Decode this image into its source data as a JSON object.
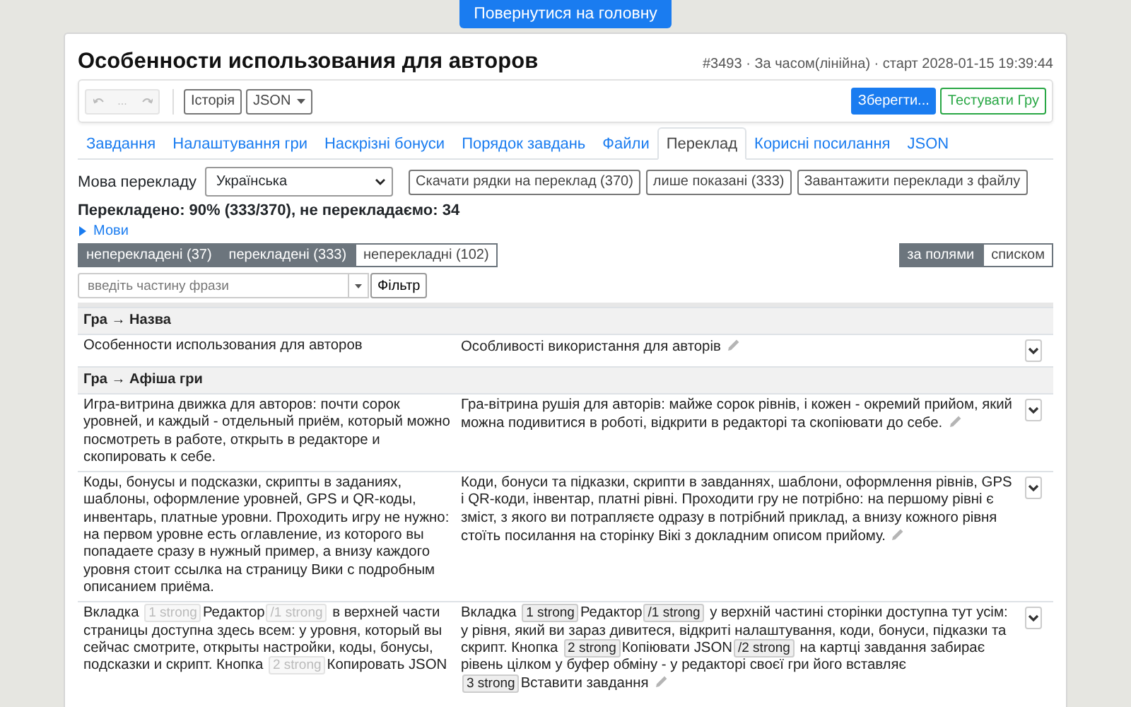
{
  "back_button": "Повернутися на головну",
  "header": {
    "title": "Особенности использования для авторов",
    "meta": "#3493 · За часом(лінійна) · старт 2028-01-15 19:39:44"
  },
  "toolbar": {
    "undo_disabled": true,
    "more_label": "...",
    "history": "Історія",
    "json_menu": "JSON",
    "save": "Зберегти...",
    "test": "Тестувати Гру"
  },
  "tabs": [
    {
      "label": "Завдання",
      "selected": false
    },
    {
      "label": "Налаштування гри",
      "selected": false
    },
    {
      "label": "Наскрізні бонуси",
      "selected": false
    },
    {
      "label": "Порядок завдань",
      "selected": false
    },
    {
      "label": "Файли",
      "selected": false
    },
    {
      "label": "Переклад",
      "selected": true
    },
    {
      "label": "Корисні посилання",
      "selected": false
    },
    {
      "label": "JSON",
      "selected": false
    }
  ],
  "language": {
    "label": "Мова перекладу",
    "value": "Українська"
  },
  "actions": [
    "Скачати рядки на переклад (370)",
    "лише показані (333)",
    "Завантажити переклади з файлу"
  ],
  "summary": "Перекладено: 90% (333/370), не перекладаємо: 34",
  "languages_toggle": {
    "label": "Мови",
    "expanded": false
  },
  "filters": [
    {
      "label": "неперекладені (37)",
      "selected": true
    },
    {
      "label": "перекладені (333)",
      "selected": true
    },
    {
      "label": "неперекладні (102)",
      "selected": false
    }
  ],
  "views": [
    {
      "label": "за полями",
      "selected": true
    },
    {
      "label": "списком",
      "selected": false
    }
  ],
  "search": {
    "placeholder": "введіть частину фрази",
    "button": "Фільтр"
  },
  "rows": [
    {
      "kind": "section",
      "title": "Гра → Назва"
    },
    {
      "kind": "entry",
      "source": [
        {
          "kind": "text",
          "text": "Особенности использования для авторов"
        }
      ],
      "target": [
        {
          "kind": "text",
          "text": "Особливості використання для авторів"
        }
      ]
    },
    {
      "kind": "section",
      "title": "Гра → Афіша гри"
    },
    {
      "kind": "entry",
      "source": [
        {
          "kind": "text",
          "text": "Игра-витрина движка для авторов: почти сорок уровней, и каждый - отдельный приём, который можно посмотреть в работе, открыть в редакторе и скопировать к себе."
        }
      ],
      "target": [
        {
          "kind": "text",
          "text": "Гра-вітрина рушія для авторів: майже сорок рівнів, і кожен - окремий прийом, який можна подивитися в роботі, відкрити в редакторі та скопіювати до себе."
        }
      ]
    },
    {
      "kind": "entry",
      "source": [
        {
          "kind": "text",
          "text": "Коды, бонусы и подсказки, скрипты в заданиях, шаблоны, оформление уровней, GPS и QR-коды, инвентарь, платные уровни. Проходить игру не нужно: на первом уровне есть оглавление, из которого вы попадаете сразу в нужный пример, а внизу каждого уровня стоит ссылка на страницу Вики с подробным описанием приёма."
        }
      ],
      "target": [
        {
          "kind": "text",
          "text": "Коди, бонуси та підказки, скрипти в завданнях, шаблони, оформлення рівнів, GPS і QR-коди, інвентар, платні рівні. Проходити гру не потрібно: на першому рівні є зміст, з якого ви потрапляєте одразу в потрібний приклад, а внизу кожного рівня стоїть посилання на сторінку Вікі з докладним описом прийому."
        }
      ]
    },
    {
      "kind": "entry",
      "source": [
        {
          "kind": "text",
          "text": "Вкладка "
        },
        {
          "kind": "tag",
          "text": "1 strong",
          "faded": true
        },
        {
          "kind": "text",
          "text": "Редактор"
        },
        {
          "kind": "tag",
          "text": "/1 strong",
          "faded": true
        },
        {
          "kind": "text",
          "text": " в верхней части страницы доступна здесь всем: у уровня, который вы сейчас смотрите, открыты настройки, коды, бонусы, подсказки и скрипт. Кнопка "
        },
        {
          "kind": "tag",
          "text": "2 strong",
          "faded": true
        },
        {
          "kind": "text",
          "text": "Копировать JSON"
        }
      ],
      "target": [
        {
          "kind": "text",
          "text": "Вкладка "
        },
        {
          "kind": "tag",
          "text": "1 strong",
          "faded": false
        },
        {
          "kind": "text",
          "text": "Редактор"
        },
        {
          "kind": "tag",
          "text": "/1 strong",
          "faded": false
        },
        {
          "kind": "text",
          "text": " у верхній частині сторінки доступна тут усім: у рівня, який ви зараз дивитеся, відкриті налаштування, коди, бонуси, підказки та скрипт. Кнопка "
        },
        {
          "kind": "tag",
          "text": "2 strong",
          "faded": false
        },
        {
          "kind": "text",
          "text": "Копіювати JSON"
        },
        {
          "kind": "tag",
          "text": "/2 strong",
          "faded": false
        },
        {
          "kind": "text",
          "text": " на картці завдання забирає рівень цілком у буфер обміну - у редакторі своєї гри його вставляє "
        },
        {
          "kind": "tag",
          "text": "3 strong",
          "faded": false
        },
        {
          "kind": "text",
          "text": "Вставити завдання"
        }
      ]
    }
  ]
}
